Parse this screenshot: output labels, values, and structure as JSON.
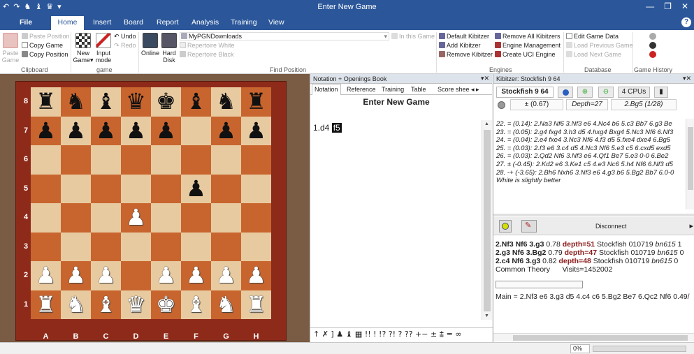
{
  "window": {
    "title": "Enter New Game"
  },
  "quick_access": [
    "↶",
    "↷",
    "♞",
    "♝",
    "♛",
    "▾"
  ],
  "window_controls": {
    "minimize": "—",
    "restore": "❐",
    "close": "✕"
  },
  "tabs": {
    "file": "File",
    "home": "Home",
    "insert": "Insert",
    "board": "Board",
    "report": "Report",
    "analysis": "Analysis",
    "training": "Training",
    "view": "View"
  },
  "help": "?",
  "ribbon": {
    "clipboard": {
      "paste": "Paste Game",
      "paste_position": "Paste Position",
      "copy_game": "Copy Game",
      "copy_position": "Copy Position",
      "group": "Clipboard"
    },
    "game": {
      "new_game": "New Game▾",
      "input_mode": "Input mode",
      "undo": "Undo",
      "redo": "Redo",
      "group": "game"
    },
    "find": {
      "online": "Online",
      "hard_disk": "Hard Disk",
      "db_value": "MyPGNDownloads",
      "in_this_game": "In this Game",
      "rep_white": "Repertoire White",
      "rep_black": "Repertoire Black",
      "group": "Find Position"
    },
    "engines": {
      "default_kibitzer": "Default Kibitzer",
      "add_kibitzer": "Add Kibitzer",
      "remove_kibitzer": "Remove Kibitzer",
      "remove_all": "Remove All Kibitzers",
      "engine_mgmt": "Engine Management",
      "create_uci": "Create UCI Engine",
      "group": "Engines"
    },
    "database": {
      "edit_game_data": "Edit Game Data",
      "load_previous": "Load Previous Game",
      "load_next": "Load Next Game",
      "group": "Database"
    },
    "history": {
      "group": "Game History"
    }
  },
  "board": {
    "ranks": [
      "8",
      "7",
      "6",
      "5",
      "4",
      "3",
      "2",
      "1"
    ],
    "files": [
      "A",
      "B",
      "C",
      "D",
      "E",
      "F",
      "G",
      "H"
    ],
    "position": [
      "rnbqkbnr",
      "ppppp.pp",
      "........",
      ".....p..",
      "...P....",
      "........",
      "PPP.PPPP",
      "RNBQKBNR"
    ]
  },
  "notation": {
    "panel_title": "Notation + Openings Book",
    "tabs": [
      "Notation",
      "Reference",
      "Training",
      "Table",
      "Score shee"
    ],
    "heading": "Enter New Game",
    "move_text": "1.d4",
    "current_move": "f5",
    "symbols": "↑ ✗ ] ♟ ♝ ▦ !! ! !? ?! ? ?? +− ± ⩲ = ∞"
  },
  "kibitzer": {
    "panel_title": "Kibitzer: Stockfish 9 64",
    "engine": "Stockfish 9 64",
    "cpus": "4 CPUs",
    "eval": "± (0.67)",
    "depth": "Depth=27",
    "current": "2.Bg5 (1/28)",
    "lines": [
      "22. = (0.14): 2.Na3 Nf6 3.Nf3 e6 4.Nc4 b6 5.c3 Bb7 6.g3 Be",
      "23. = (0.05): 2.g4 fxg4 3.h3 d5 4.hxg4 Bxg4 5.Nc3 Nf6 6.Nf3",
      "24. = (0.04): 2.e4 fxe4 3.Nc3 Nf6 4.f3 d5 5.fxe4 dxe4 6.Bg5",
      "25. = (0.03): 2.f3 e6 3.c4 d5 4.Nc3 Nf6 5.e3 c5 6.cxd5 exd5",
      "26. = (0.03): 2.Qd2 Nf6 3.Nf3 e6 4.Qf1 Be7 5.e3 0-0 6.Be2",
      "27. ± (-0.45): 2.Kd2 e6 3.Ke1 c5 4.e3 Nc6 5.h4 Nf6 6.Nf3 d5",
      "28. -+ (-3.65): 2.Bh6 Nxh6 3.Nf3 e6 4.g3 b6 5.Bg2 Bb7 6.0-0"
    ],
    "assessment": "White is slightly better",
    "disconnect": "Disconnect",
    "cloud": [
      {
        "move": "2.Nf3 Nf6 3.g3",
        "score": "0.78",
        "depth": "depth=51",
        "engine": "Stockfish 010719",
        "user": "bn615",
        "tail": "1"
      },
      {
        "move": "2.g3 Nf6 3.Bg2",
        "score": "0.79",
        "depth": "depth=47",
        "engine": "Stockfish 010719",
        "user": "bn615",
        "tail": "0"
      },
      {
        "move": "2.c4 Nf6 3.g3",
        "score": "0.82",
        "depth": "depth=48",
        "engine": "Stockfish 010719",
        "user": "bn615",
        "tail": "0"
      }
    ],
    "theory": "Common Theory",
    "visits": "Visits=1452002",
    "main": "Main = 2.Nf3 e6 3.g3 d5 4.c4 c6 5.Bg2 Be7 6.Qc2 Nf6  0.49/"
  },
  "status": {
    "percent": "0%"
  }
}
